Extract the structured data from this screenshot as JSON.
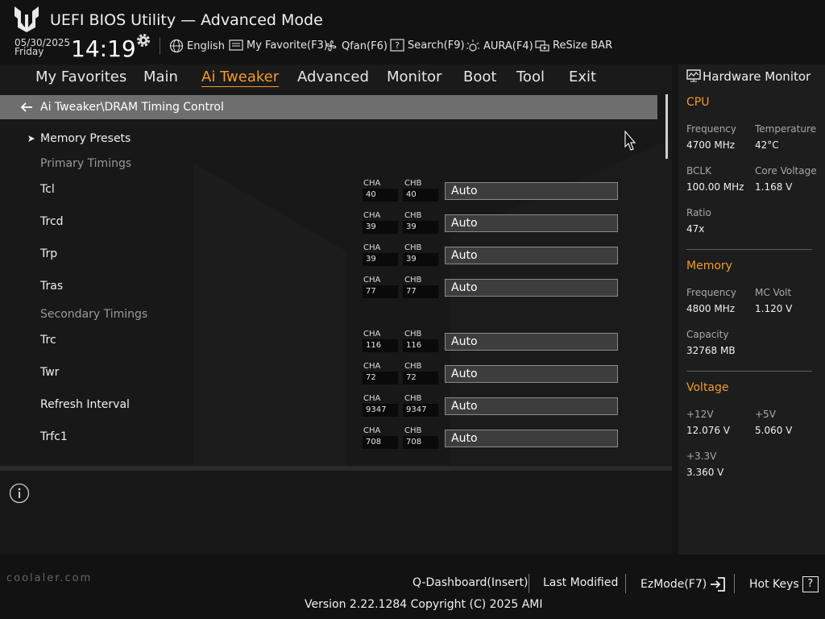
{
  "header": {
    "title": "UEFI BIOS Utility — Advanced Mode",
    "date": "05/30/2025",
    "day": "Friday",
    "time": "14:19",
    "toolbar": [
      {
        "label": "English",
        "icon": "globe-icon"
      },
      {
        "label": "My Favorite(F3)",
        "icon": "favorite-icon"
      },
      {
        "label": "Qfan(F6)",
        "icon": "fan-icon"
      },
      {
        "label": "Search(F9)",
        "icon": "search-icon"
      },
      {
        "label": "AURA(F4)",
        "icon": "aura-icon"
      },
      {
        "label": "ReSize BAR",
        "icon": "resize-bar-icon"
      }
    ]
  },
  "nav": {
    "tabs": [
      "My Favorites",
      "Main",
      "Ai Tweaker",
      "Advanced",
      "Monitor",
      "Boot",
      "Tool",
      "Exit"
    ],
    "active": "Ai Tweaker"
  },
  "breadcrumb": "Ai Tweaker\\DRAM Timing Control",
  "main": {
    "memory_presets": "Memory Presets",
    "primary_title": "Primary Timings",
    "secondary_title": "Secondary Timings",
    "cha_label": "CHA",
    "chb_label": "CHB",
    "primary": [
      {
        "name": "Tcl",
        "cha": "40",
        "chb": "40",
        "value": "Auto"
      },
      {
        "name": "Trcd",
        "cha": "39",
        "chb": "39",
        "value": "Auto"
      },
      {
        "name": "Trp",
        "cha": "39",
        "chb": "39",
        "value": "Auto"
      },
      {
        "name": "Tras",
        "cha": "77",
        "chb": "77",
        "value": "Auto"
      }
    ],
    "secondary": [
      {
        "name": "Trc",
        "cha": "116",
        "chb": "116",
        "value": "Auto"
      },
      {
        "name": "Twr",
        "cha": "72",
        "chb": "72",
        "value": "Auto"
      },
      {
        "name": "Refresh Interval",
        "cha": "9347",
        "chb": "9347",
        "value": "Auto"
      },
      {
        "name": "Trfc1",
        "cha": "708",
        "chb": "708",
        "value": "Auto"
      }
    ]
  },
  "hw": {
    "title": "Hardware Monitor",
    "cpu": {
      "title": "CPU",
      "frequency_label": "Frequency",
      "frequency": "4700 MHz",
      "temperature_label": "Temperature",
      "temperature": "42°C",
      "bclk_label": "BCLK",
      "bclk": "100.00 MHz",
      "core_voltage_label": "Core Voltage",
      "core_voltage": "1.168 V",
      "ratio_label": "Ratio",
      "ratio": "47x"
    },
    "memory": {
      "title": "Memory",
      "frequency_label": "Frequency",
      "frequency": "4800 MHz",
      "mc_volt_label": "MC Volt",
      "mc_volt": "1.120 V",
      "capacity_label": "Capacity",
      "capacity": "32768 MB"
    },
    "voltage": {
      "title": "Voltage",
      "v12_label": "+12V",
      "v12": "12.076 V",
      "v5_label": "+5V",
      "v5": "5.060 V",
      "v33_label": "+3.3V",
      "v33": "3.360 V"
    }
  },
  "footer": {
    "qdashboard": "Q-Dashboard(Insert)",
    "last_modified": "Last Modified",
    "ezmode": "EzMode(F7)",
    "hotkeys": "Hot Keys",
    "hotkeys_glyph": "?",
    "version": "Version 2.22.1284 Copyright (C) 2025 AMI",
    "watermark": "coolaler.com"
  },
  "colors": {
    "accent": "#f39a32",
    "background": "#141414",
    "breadcrumb_bar": "#6e6e6e"
  }
}
